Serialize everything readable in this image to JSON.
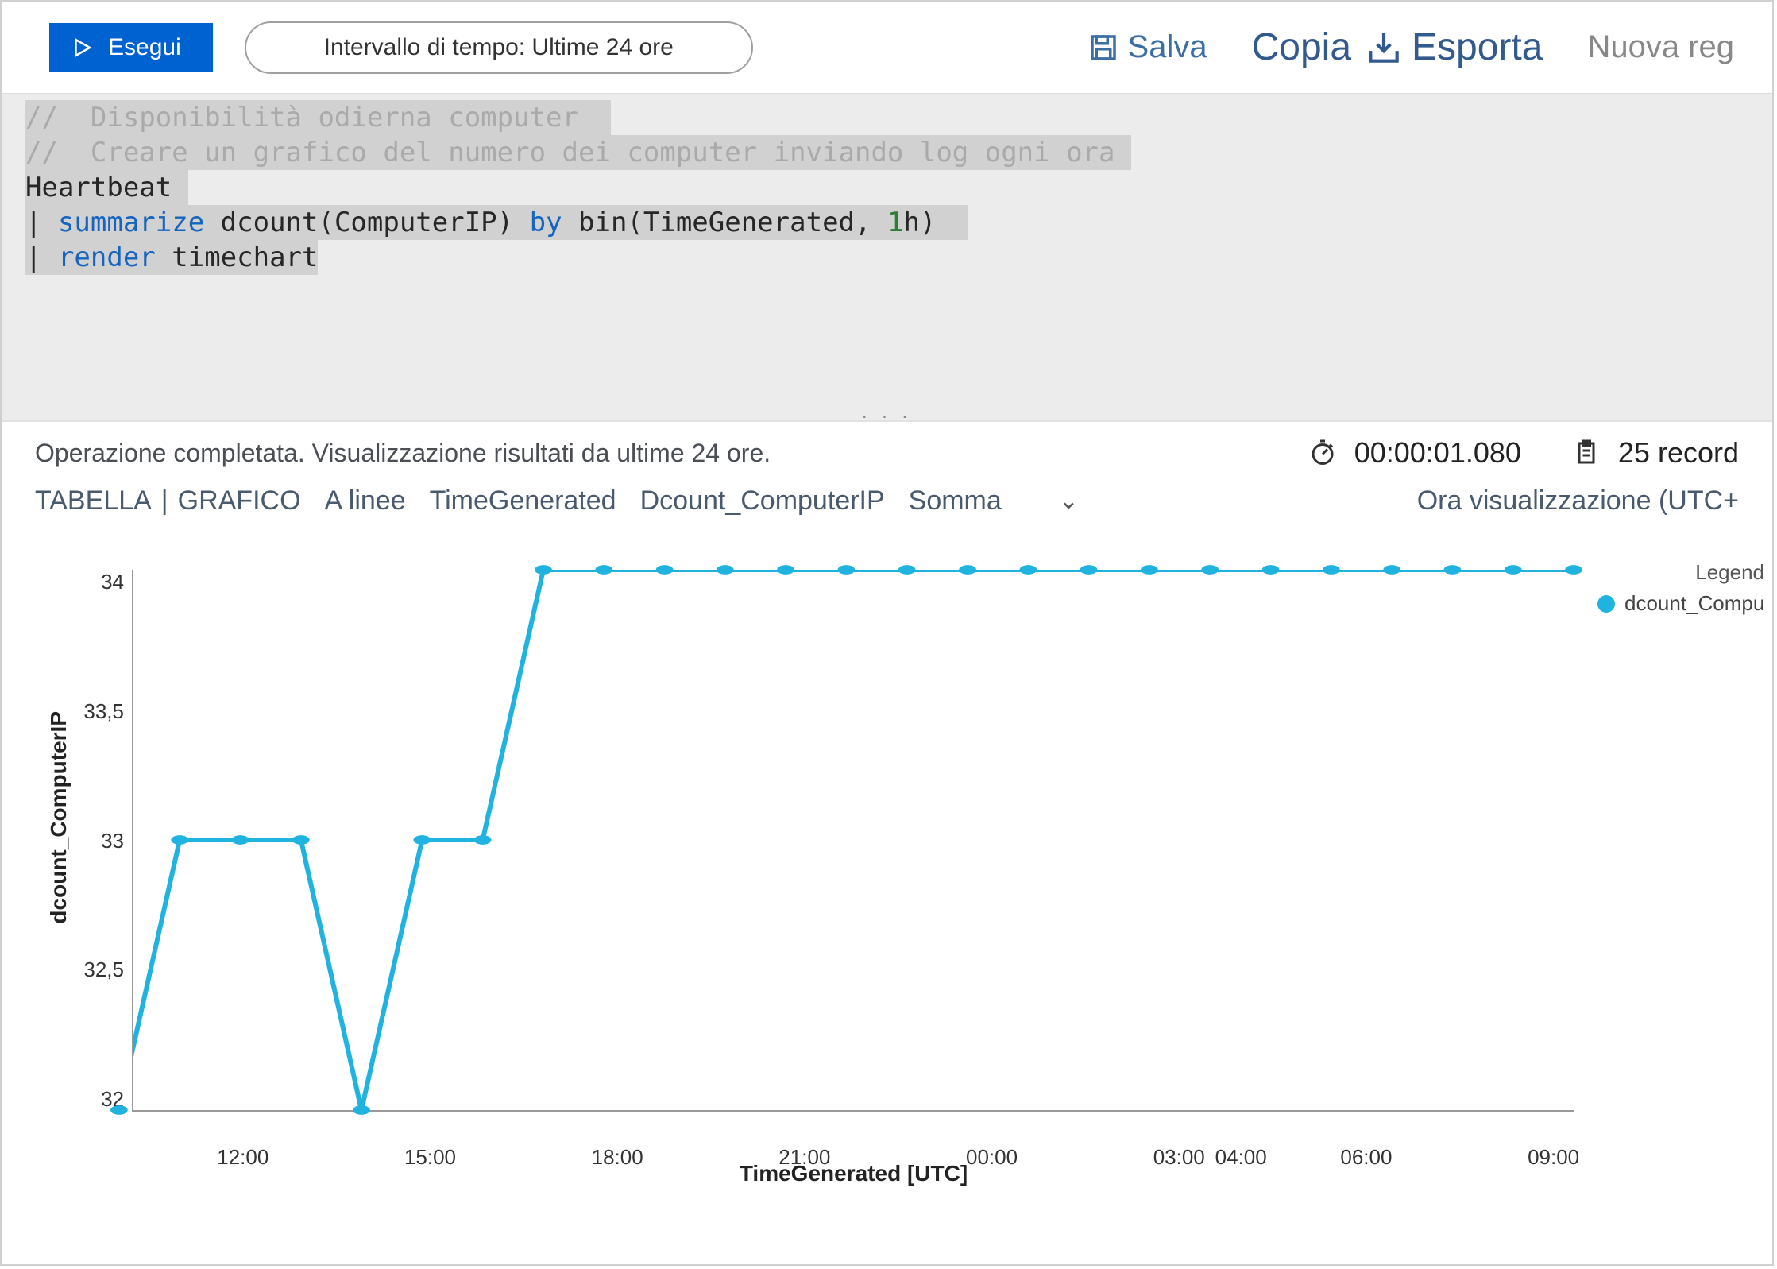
{
  "toolbar": {
    "run_label": "Esegui",
    "time_range": "Intervallo di tempo: Ultime 24 ore",
    "save_label": "Salva",
    "copy_label": "Copia",
    "export_label": "Esporta",
    "new_rule_label": "Nuova reg"
  },
  "editor": {
    "line1_prefix": "//  ",
    "line1_text": "Disponibilità odierna computer",
    "line2_prefix": "//  ",
    "line2_text": "Creare un grafico del numero dei computer inviando log ogni ora",
    "line3": "Heartbeat",
    "line4_pipe": "| ",
    "line4_kw": "summarize",
    "line4_b": " dcount(ComputerIP) ",
    "line4_by": "by",
    "line4_c": " bin(TimeGenerated, ",
    "line4_num": "1",
    "line4_d": "h)  ",
    "line5_pipe": "| ",
    "line5_kw": "render",
    "line5_rest": " timechart"
  },
  "status": {
    "message": "Operazione completata. Visualizzazione risultati da ultime 24 ore.",
    "duration": "00:00:01.080",
    "records": "25 record"
  },
  "config": {
    "tabella": "TABELLA",
    "sep": "|",
    "grafico": "GRAFICO",
    "type": "A linee",
    "xcol": "TimeGenerated",
    "ycol": "Dcount_ComputerIP",
    "agg": "Somma",
    "tz": "Ora visualizzazione (UTC+"
  },
  "legend": {
    "title": "Legend",
    "series": "dcount_Compu"
  },
  "chart_data": {
    "type": "line",
    "xlabel": "TimeGenerated [UTC]",
    "ylabel": "dcount_ComputerIP",
    "ylim": [
      32,
      34
    ],
    "y_ticks": [
      "34",
      "33,5",
      "33",
      "32,5",
      "32"
    ],
    "x_ticks": [
      {
        "pos": 7.6,
        "label": "12:00"
      },
      {
        "pos": 20.6,
        "label": "15:00"
      },
      {
        "pos": 33.6,
        "label": "18:00"
      },
      {
        "pos": 46.6,
        "label": "21:00"
      },
      {
        "pos": 59.6,
        "label": "00:00"
      },
      {
        "pos": 72.6,
        "label": "03:00"
      },
      {
        "pos": 76.9,
        "label": "04:00"
      },
      {
        "pos": 85.6,
        "label": "06:00"
      },
      {
        "pos": 98.6,
        "label": "09:00"
      }
    ],
    "series": [
      {
        "name": "dcount_ComputerIP",
        "color": "#21b3e0",
        "x": [
          "10:00",
          "11:00",
          "12:00",
          "13:00",
          "14:00",
          "15:00",
          "16:00",
          "17:00",
          "18:00",
          "19:00",
          "20:00",
          "21:00",
          "22:00",
          "23:00",
          "00:00",
          "01:00",
          "02:00",
          "03:00",
          "04:00",
          "05:00",
          "06:00",
          "07:00",
          "08:00",
          "09:00",
          "10:00"
        ],
        "values": [
          32,
          33,
          33,
          33,
          32,
          33,
          33,
          34,
          34,
          34,
          34,
          34,
          34,
          34,
          34,
          34,
          34,
          34,
          34,
          34,
          34,
          34,
          34,
          34,
          34
        ]
      }
    ]
  }
}
